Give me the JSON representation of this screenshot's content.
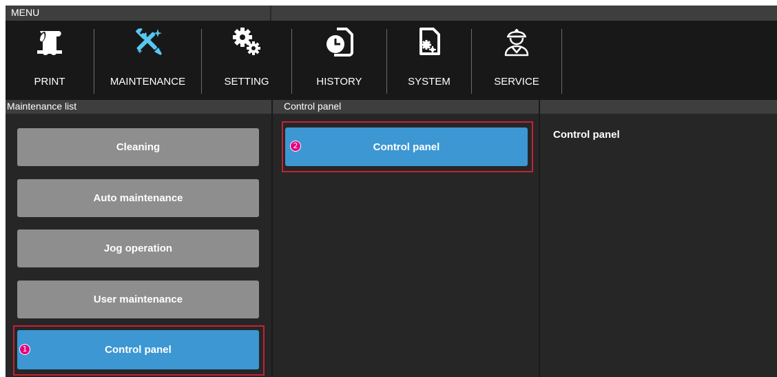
{
  "menu": {
    "title": "MENU"
  },
  "toolbar": {
    "items": [
      {
        "label": "PRINT",
        "icon": "print-icon"
      },
      {
        "label": "MAINTENANCE",
        "icon": "maintenance-tools-icon"
      },
      {
        "label": "SETTING",
        "icon": "gears-icon"
      },
      {
        "label": "HISTORY",
        "icon": "history-clock-icon"
      },
      {
        "label": "SYSTEM",
        "icon": "system-file-icon"
      },
      {
        "label": "SERVICE",
        "icon": "service-engineer-icon"
      }
    ]
  },
  "maintenance_list": {
    "header": "Maintenance list",
    "items": [
      {
        "label": "Cleaning"
      },
      {
        "label": "Auto maintenance"
      },
      {
        "label": "Jog operation"
      },
      {
        "label": "User maintenance"
      },
      {
        "label": "Control panel",
        "selected": true,
        "step": "1"
      }
    ]
  },
  "control_panel_list": {
    "header": "Control panel",
    "items": [
      {
        "label": "Control panel",
        "selected": true,
        "step": "2"
      }
    ]
  },
  "detail": {
    "title": "Control panel"
  },
  "colors": {
    "background": "#262626",
    "toolbar": "#181818",
    "header": "#3e3e3e",
    "button_gray": "#8e8e8e",
    "button_selected": "#3c97d3",
    "highlight": "#c42236",
    "step_badge": "#e6007e"
  }
}
